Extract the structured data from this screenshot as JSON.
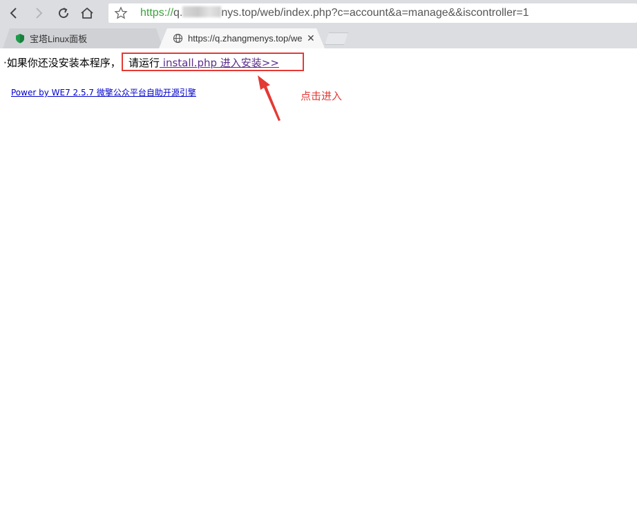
{
  "browser": {
    "url_scheme": "https://",
    "url_host_start": "q.",
    "url_host_end": "nys.top",
    "url_path": "/web/index.php?c=account&a=manage&&iscontroller=1",
    "tabs": [
      {
        "label": "宝塔Linux面板",
        "active": false
      },
      {
        "label": "https://q.zhangmenys.top/we",
        "active": true
      }
    ]
  },
  "page": {
    "prefix": "·如果你还没安装本程序，",
    "run_label": "请运行",
    "install_link": " install.php 进入安装>>",
    "power_by": "Power by WE7 2.5.7  微擎公众平台自助开源引擎"
  },
  "annotation": {
    "label": "点击进入",
    "color": "#e53935"
  }
}
